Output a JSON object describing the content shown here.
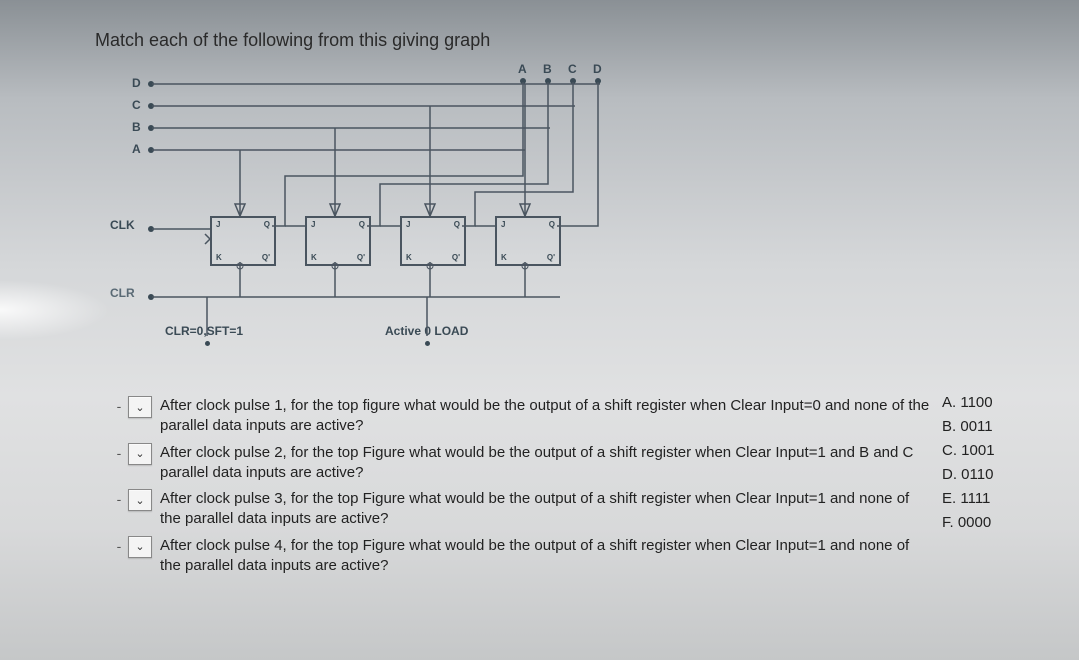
{
  "prompt": "Match each of the following from this giving graph",
  "diagram": {
    "side_inputs": [
      "D",
      "C",
      "B",
      "A"
    ],
    "top_outputs": [
      "A",
      "B",
      "C",
      "D"
    ],
    "clk_label": "CLK",
    "clr_label": "CLR",
    "mode_label": "CLR=0,SFT=1",
    "load_label": "Active 0 LOAD",
    "ff_pins": {
      "top_left": "J",
      "top_right": "Q",
      "bottom_left": "K",
      "bottom_right": "Q'"
    }
  },
  "questions": [
    "After clock pulse 1, for the top figure what would be the output of a shift register when Clear Input=0 and none of the parallel data inputs are active?",
    "After clock pulse 2, for the top Figure  what would be the output of a shift register when Clear Input=1 and B and C parallel data inputs are active?",
    "After clock pulse 3, for the top Figure  what would be the output of a shift register when Clear Input=1 and none of the parallel data inputs are active?",
    "After clock pulse 4, for the top Figure what would be the output of a shift register when Clear Input=1 and none of the parallel data inputs are active?"
  ],
  "answers": [
    {
      "letter": "A.",
      "value": "1100"
    },
    {
      "letter": "B.",
      "value": "0011"
    },
    {
      "letter": "C.",
      "value": "1001"
    },
    {
      "letter": "D.",
      "value": "0110"
    },
    {
      "letter": "E.",
      "value": "1111"
    },
    {
      "letter": "F.",
      "value": "0000"
    }
  ],
  "marker": "-",
  "chevron": "⌄"
}
